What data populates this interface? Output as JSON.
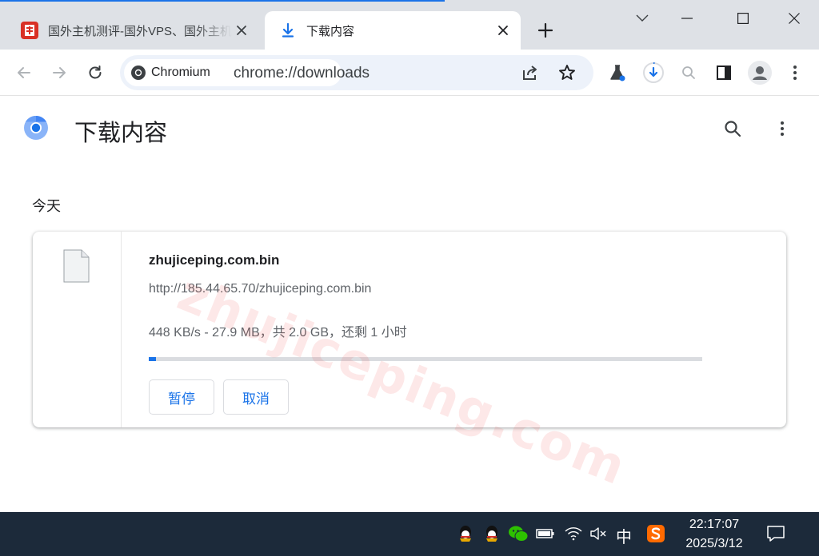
{
  "browser": {
    "tabs": [
      {
        "title": "国外主机测评-国外VPS、国外主机"
      },
      {
        "title": "下载内容"
      }
    ],
    "omnibox": {
      "chip_label": "Chromium",
      "url": "chrome://downloads"
    }
  },
  "page": {
    "title": "下载内容",
    "section": "今天",
    "watermark": "zhujiceping.com"
  },
  "download": {
    "file_name": "zhujiceping.com.bin",
    "source_url": "http://185.44.65.70/zhujiceping.com.bin",
    "status": "448 KB/s - 27.9 MB，共 2.0 GB，还剩 1 小时",
    "progress_fraction": 0.0136,
    "pause_label": "暂停",
    "cancel_label": "取消"
  },
  "taskbar": {
    "ime_label": "中",
    "time": "22:17:07",
    "date": "2025/3/12"
  },
  "colors": {
    "accent": "#1a73e8",
    "tabstrip": "#dee1e6",
    "omnibox": "#edf2fa",
    "taskbar": "#1c2a3a"
  }
}
